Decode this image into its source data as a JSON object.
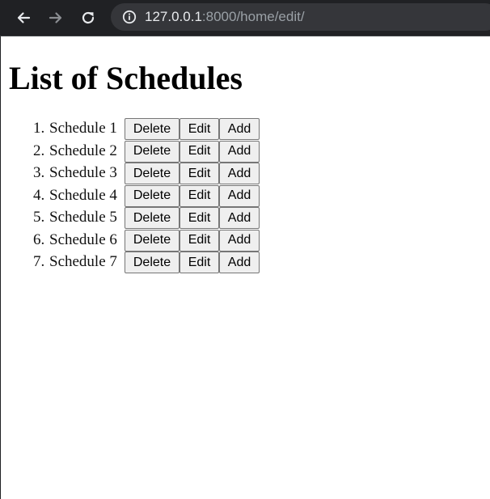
{
  "browser": {
    "url_host": "127.0.0.1",
    "url_rest": ":8000/home/edit/",
    "icons": [
      "back-icon",
      "forward-icon",
      "reload-icon",
      "info-icon"
    ]
  },
  "page": {
    "title": "List of Schedules",
    "delete_label": "Delete",
    "edit_label": "Edit",
    "add_label": "Add",
    "schedules": [
      {
        "number": "1.",
        "name": "Schedule 1"
      },
      {
        "number": "2.",
        "name": "Schedule 2"
      },
      {
        "number": "3.",
        "name": "Schedule 3"
      },
      {
        "number": "4.",
        "name": "Schedule 4"
      },
      {
        "number": "5.",
        "name": "Schedule 5"
      },
      {
        "number": "6.",
        "name": "Schedule 6"
      },
      {
        "number": "7.",
        "name": "Schedule 7"
      }
    ]
  }
}
